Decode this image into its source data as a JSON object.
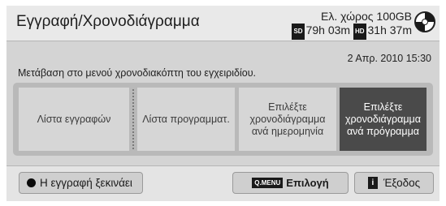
{
  "header": {
    "title": "Εγγραφή/Χρονοδιάγραμμα",
    "storage_free": "Ελ. χώρος 100GB",
    "sd_badge": "SD",
    "sd_time": "79h 03m",
    "hd_badge": "HD",
    "hd_time": "31h 37m"
  },
  "description": "Μετάβαση στο μενού χρονοδιακόπτη του εγχειριδίου.",
  "datetime": "2 Απρ. 2010 15:30",
  "options": [
    {
      "label": "Λίστα εγγραφών"
    },
    {
      "label": "Λίστα προγραμματ."
    },
    {
      "label": "Επιλέξτε χρονοδιάγραμμα ανά ημερομηνία"
    },
    {
      "label": "Επιλέξτε χρονοδιάγραμμα ανά πρόγραμμα",
      "selected": true
    }
  ],
  "footer": {
    "record_label": "Η εγγραφή ξεκινάει",
    "qmenu_key": "Q.MENU",
    "qmenu_label": "Επιλογή",
    "exit_key": "i",
    "exit_label": "Έξοδος"
  },
  "colors": {
    "panel_bg": "#d4d4d4",
    "selected_bg": "#4a4a4a",
    "option_bg": "#d6d6d6"
  },
  "icons": {
    "storage": "disc-icon",
    "record": "record-dot-icon",
    "exit": "info-key-icon"
  }
}
